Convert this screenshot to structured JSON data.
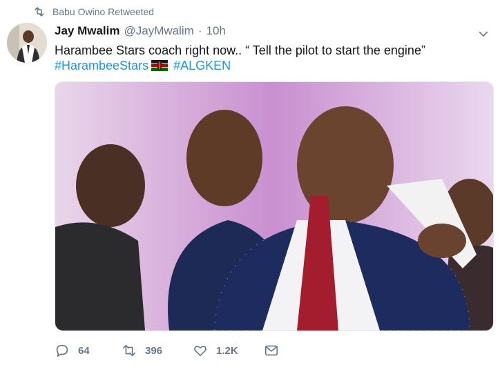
{
  "retweet_header": {
    "icon": "retweet-icon",
    "text": "Babu Owino Retweeted"
  },
  "tweet": {
    "display_name": "Jay Mwalim",
    "handle": "@JayMwalim",
    "separator": "·",
    "time": "10h",
    "text": "Harambee Stars coach right now.. “ Tell the pilot to start the engine”",
    "hashtags": [
      "#HarambeeStars",
      "#ALGKEN"
    ],
    "flag_icon": "kenya-flag-icon",
    "more_icon": "chevron-down-icon"
  },
  "actions": {
    "reply_count": "64",
    "retweet_count": "396",
    "like_count": "1.2K",
    "icons": [
      "reply-icon",
      "retweet-icon",
      "like-icon",
      "direct-message-icon"
    ]
  },
  "colors": {
    "link": "#1b95e0",
    "muted": "#657786",
    "text": "#14171a"
  }
}
